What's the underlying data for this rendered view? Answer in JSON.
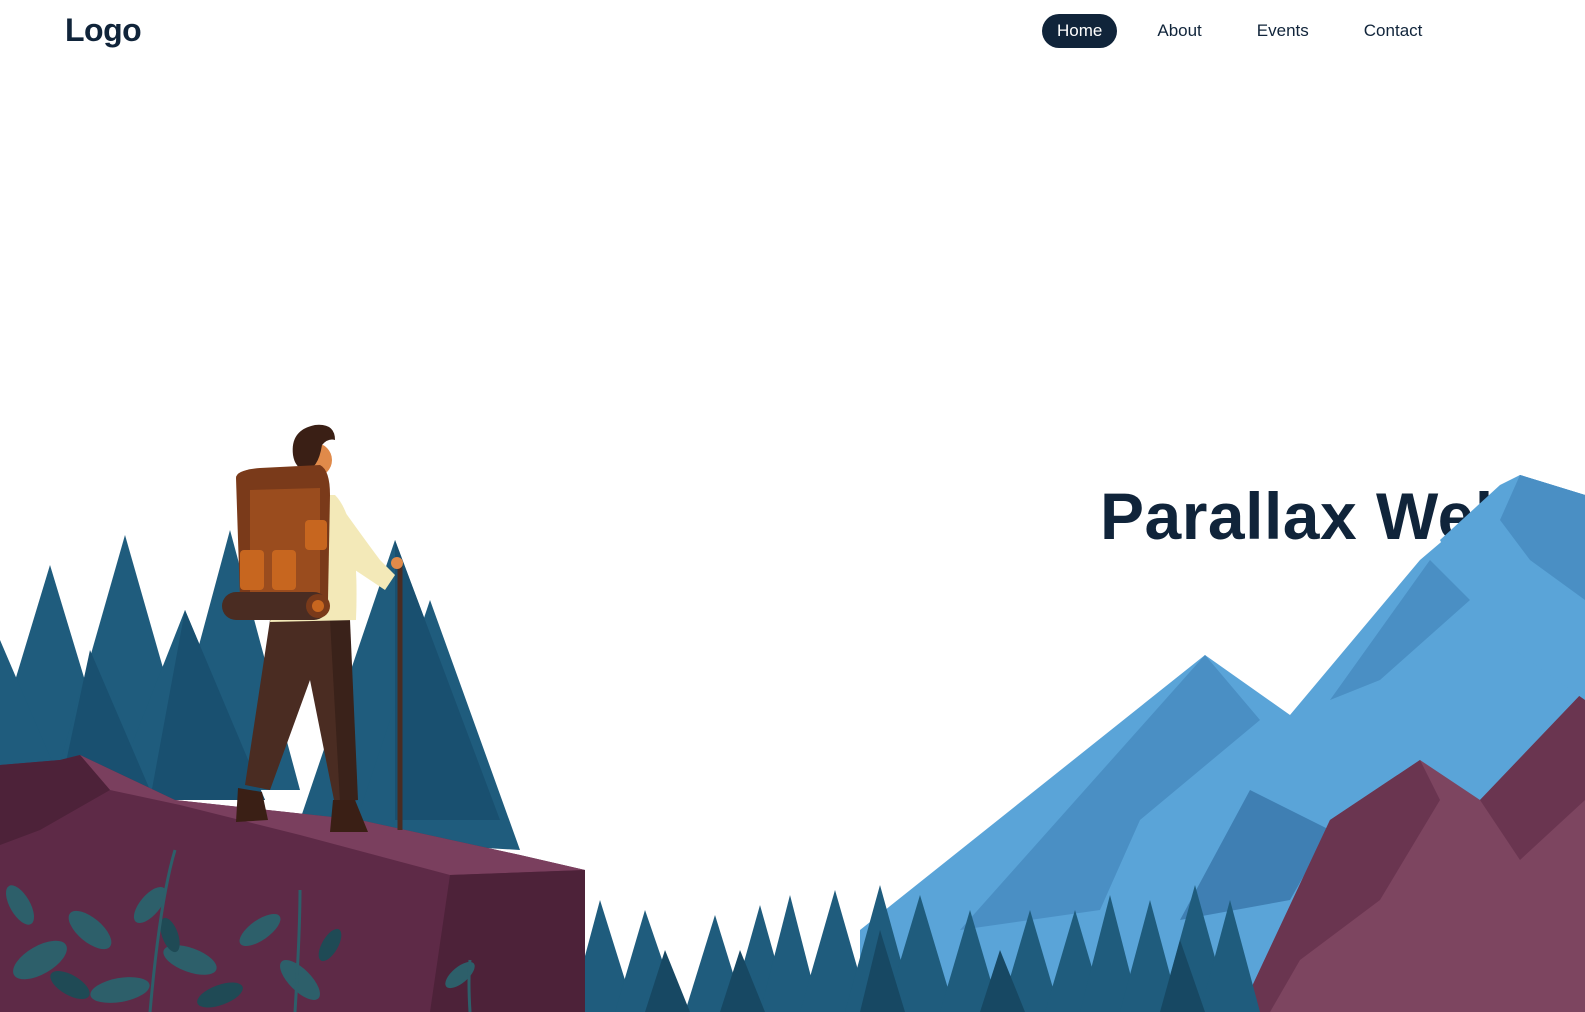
{
  "header": {
    "logo": "Logo",
    "nav": [
      {
        "label": "Home",
        "active": true
      },
      {
        "label": "About",
        "active": false
      },
      {
        "label": "Events",
        "active": false
      },
      {
        "label": "Contact",
        "active": false
      }
    ]
  },
  "hero": {
    "title": "Parallax Website"
  },
  "colors": {
    "navy": "#10243a",
    "pine": "#1f5c7d",
    "mountain_blue": "#5aa4d8",
    "rock_plum": "#5e2a47",
    "ridge_maroon": "#7d4560",
    "leaf": "#2d5f6a"
  },
  "illustration": {
    "figure": "hiker-figure",
    "elements": [
      "pine-forest",
      "rock-cliff",
      "blue-mountains",
      "maroon-ridge",
      "foliage"
    ]
  }
}
